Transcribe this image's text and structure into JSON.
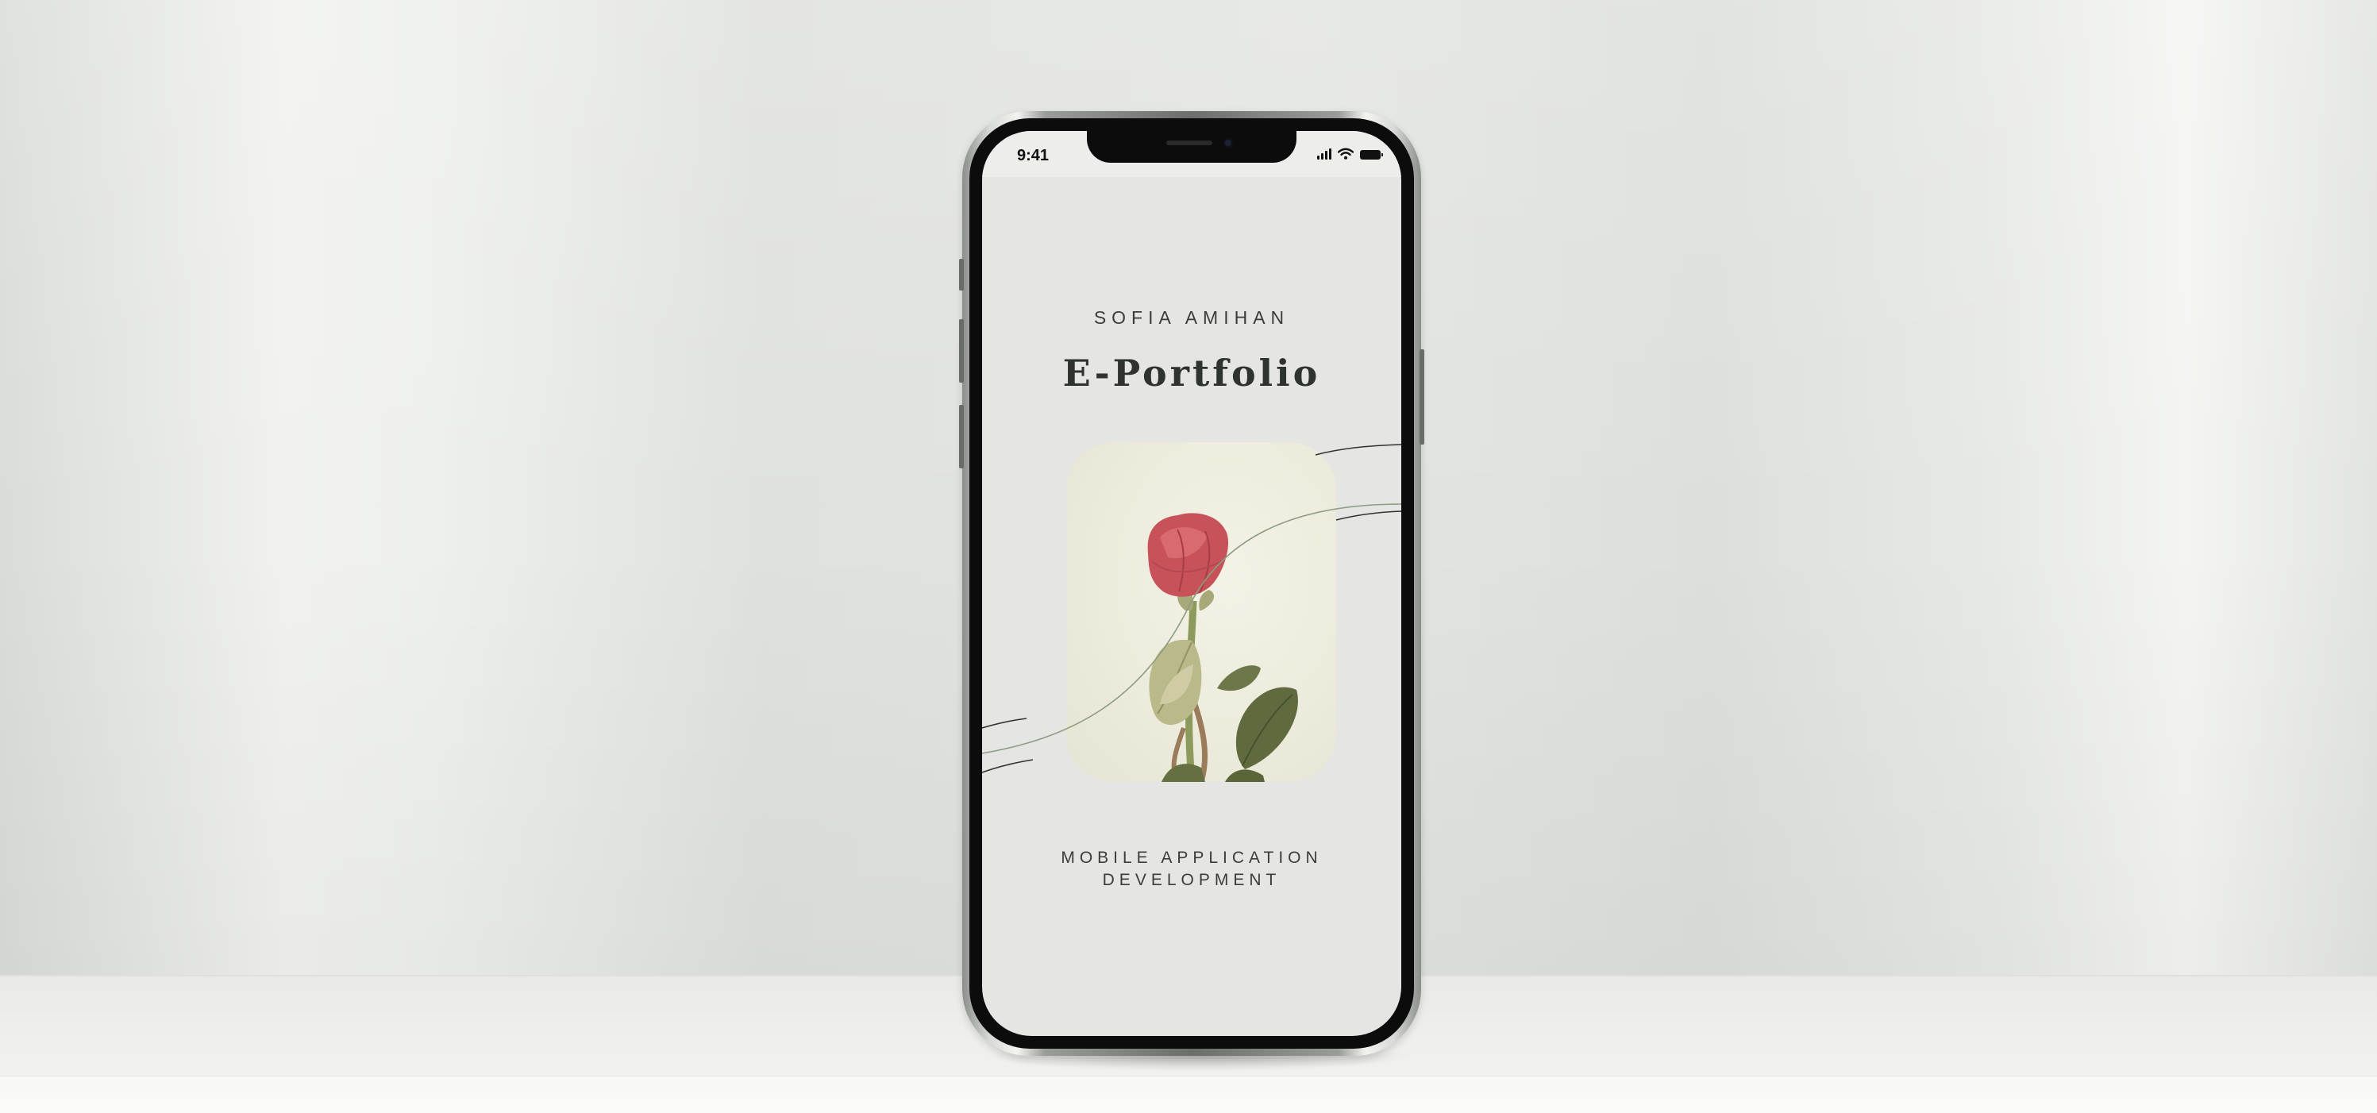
{
  "status_bar": {
    "time": "9:41"
  },
  "cover": {
    "author": "SOFIA AMIHAN",
    "title": "E-Portfolio",
    "subtitle_line1": "MOBILE APPLICATION",
    "subtitle_line2": "DEVELOPMENT"
  },
  "colors": {
    "screen_background": "#e5e5e4",
    "text_dark": "#2f3330",
    "rose_petal": "#c8525a",
    "leaf": "#6f7a4e"
  },
  "icons": [
    "signal-icon",
    "wifi-icon",
    "battery-icon"
  ]
}
